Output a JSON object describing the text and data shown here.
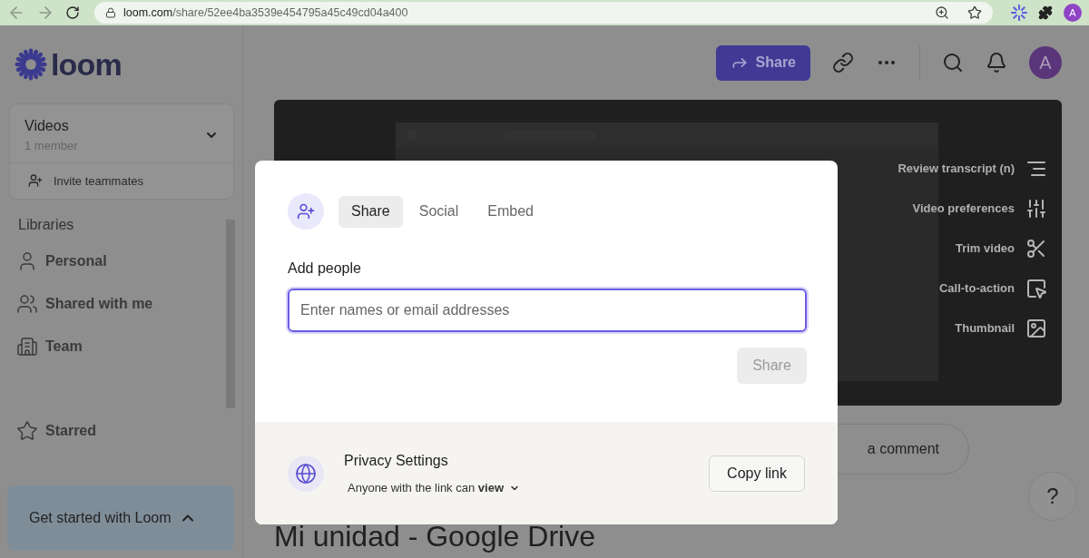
{
  "browser": {
    "url_host": "loom.com",
    "url_path": "/share/52ee4ba3539e454795a45c49cd04a400",
    "profile_initial": "A"
  },
  "sidebar": {
    "logo_text": "loom",
    "workspace": {
      "name": "Videos",
      "members": "1 member",
      "invite": "Invite teammates"
    },
    "libraries_heading": "Libraries",
    "items": [
      {
        "label": "Personal"
      },
      {
        "label": "Shared with me"
      },
      {
        "label": "Team"
      },
      {
        "label": "Starred"
      }
    ],
    "get_started": "Get started with Loom"
  },
  "header": {
    "share_button": "Share",
    "avatar_initial": "A"
  },
  "video_menu": [
    {
      "label": "Review transcript (n)"
    },
    {
      "label": "Video preferences"
    },
    {
      "label": "Trim video"
    },
    {
      "label": "Call-to-action"
    },
    {
      "label": "Thumbnail"
    }
  ],
  "comment_button": "a comment",
  "video_title": "Mi unidad - Google Drive",
  "help_button": "?",
  "dialog": {
    "tabs": [
      {
        "label": "Share",
        "selected": true
      },
      {
        "label": "Social",
        "selected": false
      },
      {
        "label": "Embed",
        "selected": false
      }
    ],
    "add_people_label": "Add people",
    "people_field": {
      "placeholder": "Enter names or email addresses"
    },
    "share_button": {
      "label": "Share",
      "disabled": true
    },
    "privacy": {
      "title": "Privacy Settings",
      "description": "Anyone with the link can **view**"
    },
    "copy_link": "Copy link"
  }
}
